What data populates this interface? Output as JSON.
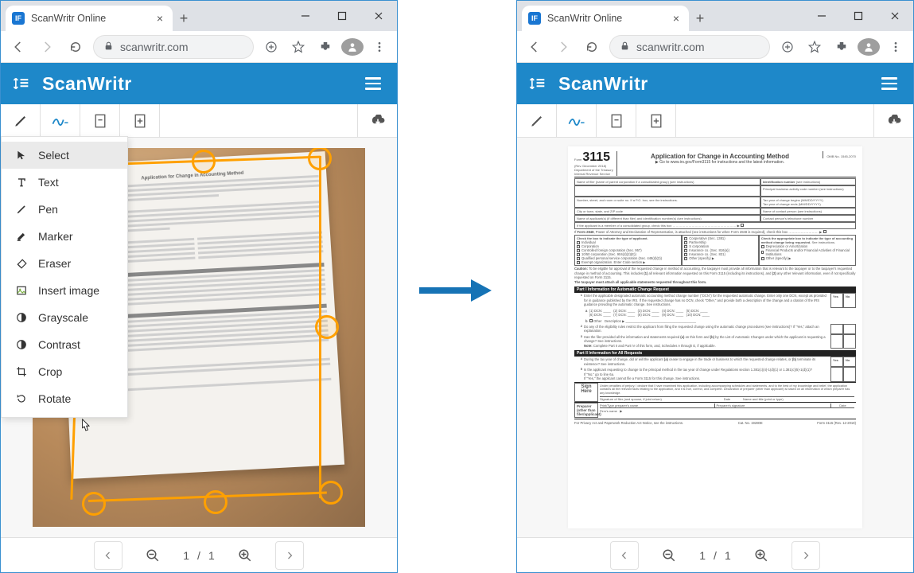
{
  "browser": {
    "tab_title": "ScanWritr Online",
    "url": "scanwritr.com"
  },
  "app": {
    "brand": "ScanWritr"
  },
  "dropdown": {
    "items": [
      {
        "label": "Select"
      },
      {
        "label": "Text"
      },
      {
        "label": "Pen"
      },
      {
        "label": "Marker"
      },
      {
        "label": "Eraser"
      },
      {
        "label": "Insert image"
      },
      {
        "label": "Grayscale"
      },
      {
        "label": "Contrast"
      },
      {
        "label": "Crop"
      },
      {
        "label": "Rotate"
      }
    ]
  },
  "pager": {
    "current": "1",
    "separator": "/",
    "total": "1"
  },
  "form": {
    "number": "3115",
    "prefix": "Form",
    "dept": "Department of the Treasury\nInternal Revenue Service",
    "rev": "(Rev. December 2018)",
    "title": "Application for Change in Accounting Method",
    "goto": "▶ Go to www.irs.gov/Form3115 for instructions and the latest information.",
    "omb": "OMB No. 1545-2070",
    "part1": "Part I    Information for Automatic Change Request",
    "part2": "Part II    Information for All Requests",
    "signhere": "Sign Here",
    "preparer": "Preparer\n(other than\nfiler/applicant)",
    "footer_left": "For Privacy Act and Paperwork Reduction Act Notice, see the instructions.",
    "footer_mid": "Cat. No. 19280E",
    "footer_right": "Form 3115 (Rev. 12-2018)"
  }
}
